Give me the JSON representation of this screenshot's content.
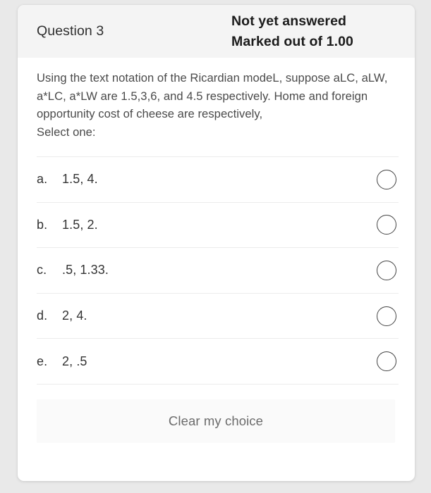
{
  "question": {
    "number_label": "Question 3",
    "status": "Not yet answered",
    "marks": "Marked out of 1.00",
    "text": "Using the text notation of the Ricardian modeL, suppose aLC, aLW, a*LC, a*LW are 1.5,3,6, and 4.5 respectively. Home and foreign opportunity cost of cheese are respectively,",
    "select_prompt": "Select one:",
    "options": [
      {
        "letter": "a.",
        "text": "1.5, 4.",
        "selected": false
      },
      {
        "letter": "b.",
        "text": "1.5, 2.",
        "selected": false
      },
      {
        "letter": "c.",
        "text": ".5, 1.33.",
        "selected": false
      },
      {
        "letter": "d.",
        "text": "2, 4.",
        "selected": false
      },
      {
        "letter": "e.",
        "text": "2, .5",
        "selected": false
      }
    ],
    "clear_button_label": "Clear my choice"
  },
  "colors": {
    "page_background": "#e9e9e9",
    "card_background": "#ffffff",
    "header_background": "#f4f4f4",
    "divider": "#ececec",
    "text_primary": "#333333",
    "text_body": "#4a4a4a",
    "button_background": "#fafafa",
    "button_text": "#6b6b6b"
  }
}
